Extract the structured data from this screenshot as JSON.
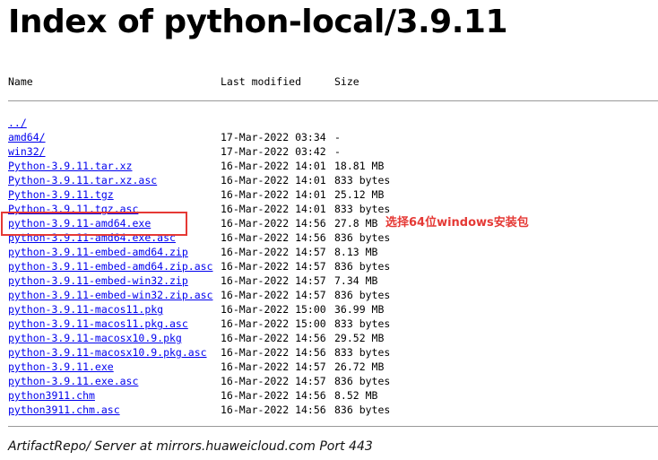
{
  "page": {
    "title": "Index of python-local/3.9.11",
    "footer": "ArtifactRepo/ Server at mirrors.huaweicloud.com Port 443"
  },
  "columns": {
    "name": "Name",
    "last_modified": "Last modified",
    "size": "Size"
  },
  "files": [
    {
      "name": "../",
      "date": "",
      "size": ""
    },
    {
      "name": "amd64/",
      "date": "17-Mar-2022 03:34",
      "size": "-"
    },
    {
      "name": "win32/",
      "date": "17-Mar-2022 03:42",
      "size": "-"
    },
    {
      "name": "Python-3.9.11.tar.xz",
      "date": "16-Mar-2022 14:01",
      "size": "18.81 MB"
    },
    {
      "name": "Python-3.9.11.tar.xz.asc",
      "date": "16-Mar-2022 14:01",
      "size": "833 bytes"
    },
    {
      "name": "Python-3.9.11.tgz",
      "date": "16-Mar-2022 14:01",
      "size": "25.12 MB"
    },
    {
      "name": "Python-3.9.11.tgz.asc",
      "date": "16-Mar-2022 14:01",
      "size": "833 bytes"
    },
    {
      "name": "python-3.9.11-amd64.exe",
      "date": "16-Mar-2022 14:56",
      "size": "27.8 MB"
    },
    {
      "name": "python-3.9.11-amd64.exe.asc",
      "date": "16-Mar-2022 14:56",
      "size": "836 bytes"
    },
    {
      "name": "python-3.9.11-embed-amd64.zip",
      "date": "16-Mar-2022 14:57",
      "size": "8.13 MB"
    },
    {
      "name": "python-3.9.11-embed-amd64.zip.asc",
      "date": "16-Mar-2022 14:57",
      "size": "836 bytes"
    },
    {
      "name": "python-3.9.11-embed-win32.zip",
      "date": "16-Mar-2022 14:57",
      "size": "7.34 MB"
    },
    {
      "name": "python-3.9.11-embed-win32.zip.asc",
      "date": "16-Mar-2022 14:57",
      "size": "836 bytes"
    },
    {
      "name": "python-3.9.11-macos11.pkg",
      "date": "16-Mar-2022 15:00",
      "size": "36.99 MB"
    },
    {
      "name": "python-3.9.11-macos11.pkg.asc",
      "date": "16-Mar-2022 15:00",
      "size": "833 bytes"
    },
    {
      "name": "python-3.9.11-macosx10.9.pkg",
      "date": "16-Mar-2022 14:56",
      "size": "29.52 MB"
    },
    {
      "name": "python-3.9.11-macosx10.9.pkg.asc",
      "date": "16-Mar-2022 14:56",
      "size": "833 bytes"
    },
    {
      "name": "python-3.9.11.exe",
      "date": "16-Mar-2022 14:57",
      "size": "26.72 MB"
    },
    {
      "name": "python-3.9.11.exe.asc",
      "date": "16-Mar-2022 14:57",
      "size": "836 bytes"
    },
    {
      "name": "python3911.chm",
      "date": "16-Mar-2022 14:56",
      "size": "8.52 MB"
    },
    {
      "name": "python3911.chm.asc",
      "date": "16-Mar-2022 14:56",
      "size": "836 bytes"
    }
  ],
  "annotation": {
    "text": "选择64位windows安装包",
    "color": "#e53935"
  },
  "colors": {
    "link": "#0000ee",
    "highlight": "#e53935"
  }
}
